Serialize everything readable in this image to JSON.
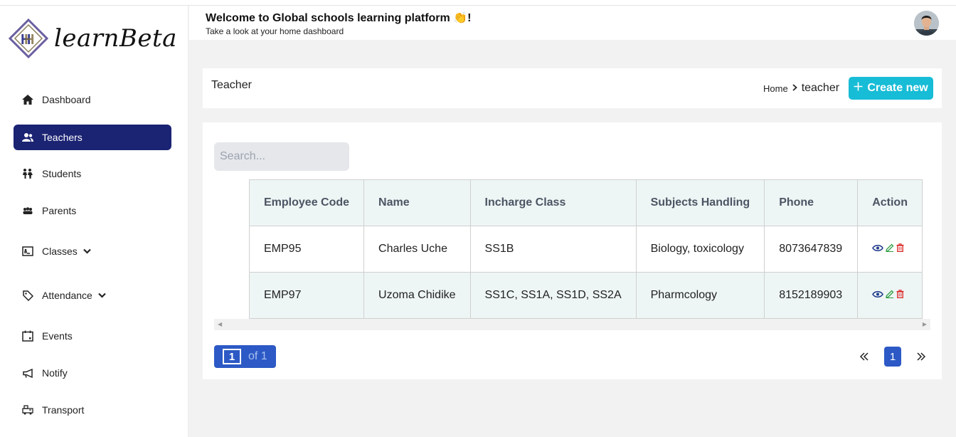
{
  "brand": {
    "logo_text": "learnBeta"
  },
  "header": {
    "welcome": "Welcome to Global schools learning platform 👏!",
    "subtitle": "Take a look at your home dashboard"
  },
  "sidebar": {
    "items": [
      {
        "label": "Dashboard",
        "icon": "home-icon"
      },
      {
        "label": "Teachers",
        "icon": "teachers-icon",
        "active": true
      },
      {
        "label": "Students",
        "icon": "students-icon"
      },
      {
        "label": "Parents",
        "icon": "parents-icon"
      },
      {
        "label": "Classes",
        "icon": "classes-icon",
        "expandable": true
      },
      {
        "label": "Attendance",
        "icon": "tag-icon",
        "expandable": true
      },
      {
        "label": "Events",
        "icon": "calendar-icon"
      },
      {
        "label": "Notify",
        "icon": "megaphone-icon"
      },
      {
        "label": "Transport",
        "icon": "transport-icon"
      }
    ]
  },
  "page": {
    "title": "Teacher",
    "breadcrumb": {
      "home": "Home",
      "current": "teacher"
    },
    "create_label": "Create new"
  },
  "search": {
    "placeholder": "Search..."
  },
  "table": {
    "columns": [
      "Employee Code",
      "Name",
      "Incharge Class",
      "Subjects Handling",
      "Phone",
      "Action"
    ],
    "rows": [
      [
        "EMP95",
        "Charles Uche",
        "SS1B",
        "Biology, toxicology",
        "8073647839"
      ],
      [
        "EMP97",
        "Uzoma Chidike",
        "SS1C, SS1A, SS1D, SS2A",
        "Pharmcology",
        "8152189903"
      ]
    ]
  },
  "pagination": {
    "current": "1",
    "of_text": "of 1",
    "page_button": "1"
  },
  "colors": {
    "sidebar_active": "#1b2373",
    "create_button": "#17bcd6",
    "pagination": "#2c59c5",
    "table_header_bg": "#eef5f5"
  }
}
